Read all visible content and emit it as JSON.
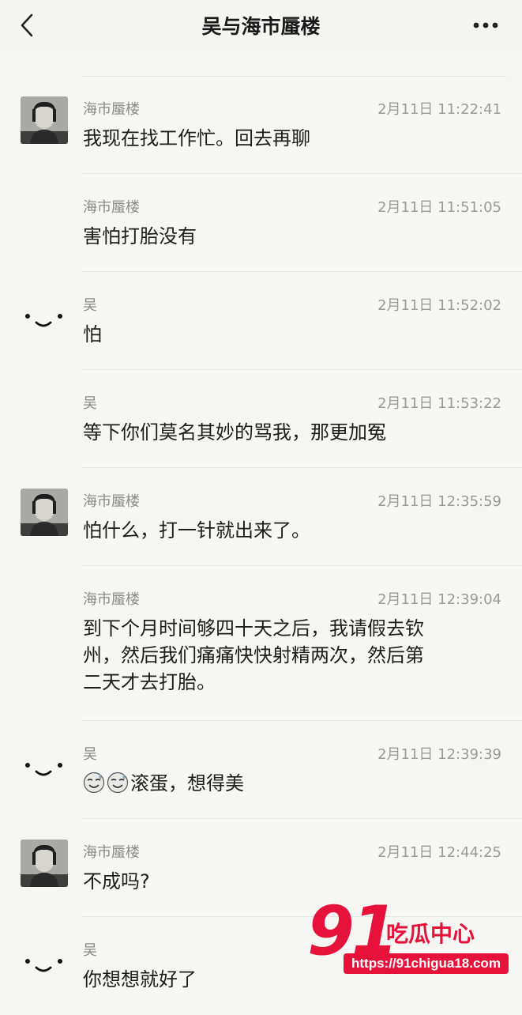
{
  "header": {
    "title": "吴与海市蜃楼"
  },
  "messages": [
    {
      "sender": "海市蜃楼",
      "time": "2月11日 11:22:41",
      "text": "我现在找工作忙。回去再聊",
      "avatar": "photo"
    },
    {
      "sender": "海市蜃楼",
      "time": "2月11日 11:51:05",
      "text": "害怕打胎没有",
      "avatar": "none"
    },
    {
      "sender": "吴",
      "time": "2月11日 11:52:02",
      "text": "怕",
      "avatar": "smile"
    },
    {
      "sender": "吴",
      "time": "2月11日 11:53:22",
      "text": "等下你们莫名其妙的骂我，那更加冤",
      "avatar": "none"
    },
    {
      "sender": "海市蜃楼",
      "time": "2月11日 12:35:59",
      "text": "怕什么，打一针就出来了。",
      "avatar": "photo"
    },
    {
      "sender": "海市蜃楼",
      "time": "2月11日 12:39:04",
      "text_lines": [
        "到下个月时间够四十天之后，我请假去钦",
        "州，然后我们痛痛快快射精两次，然后第",
        "二天才去打胎。"
      ],
      "avatar": "none"
    },
    {
      "sender": "吴",
      "time": "2月11日 12:39:39",
      "text": "滚蛋，想得美",
      "avatar": "smile",
      "emoji": [
        "sweat-smile-emoji",
        "sweat-smile-emoji"
      ]
    },
    {
      "sender": "海市蜃楼",
      "time": "2月11日 12:44:25",
      "text": "不成吗?",
      "avatar": "photo"
    },
    {
      "sender": "吴",
      "time": "",
      "text": "你想想就好了",
      "avatar": "smile"
    }
  ],
  "watermark": {
    "number": "91",
    "brand": "吃瓜中心",
    "url": "https://91chigua18.com"
  },
  "colors": {
    "background": "#f6f6f4",
    "watermark": "#e6123a"
  }
}
